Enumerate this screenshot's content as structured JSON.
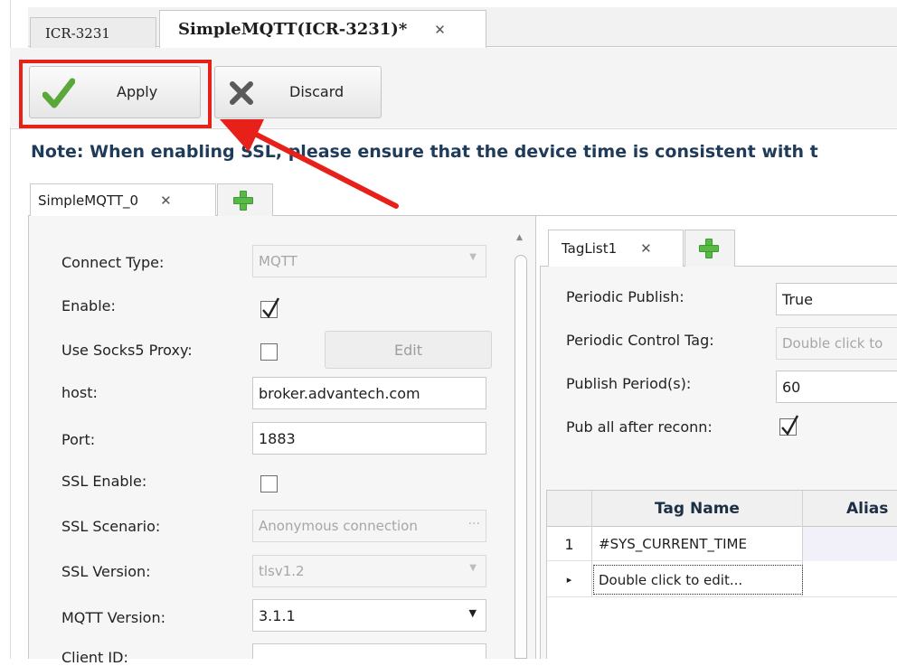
{
  "doc_tabs": [
    {
      "label": "ICR-3231"
    },
    {
      "label": "SimpleMQTT(ICR-3231)*",
      "close": "✕"
    }
  ],
  "toolbar": {
    "apply_label": "Apply",
    "discard_label": "Discard"
  },
  "note": "Note: When enabling SSL, please ensure that the device time is consistent with t",
  "config_tabs": {
    "active": "SimpleMQTT_0",
    "close": "✕"
  },
  "form": {
    "connect_type": {
      "label": "Connect Type:",
      "value": "MQTT"
    },
    "enable": {
      "label": "Enable:",
      "checked": true
    },
    "socks5": {
      "label": "Use Socks5 Proxy:",
      "checked": false,
      "edit_label": "Edit"
    },
    "host": {
      "label": "host:",
      "value": "broker.advantech.com"
    },
    "port": {
      "label": "Port:",
      "value": "1883"
    },
    "ssl_enable": {
      "label": "SSL Enable:",
      "checked": false
    },
    "ssl_scenario": {
      "label": "SSL Scenario:",
      "value": "Anonymous connection",
      "ellipsis": "···"
    },
    "ssl_version": {
      "label": "SSL Version:",
      "value": "tlsv1.2"
    },
    "mqtt_version": {
      "label": "MQTT Version:",
      "value": "3.1.1"
    },
    "client_id": {
      "label": "Client ID:",
      "value": ""
    }
  },
  "taglist": {
    "tab": "TagList1",
    "close": "✕",
    "periodic_publish": {
      "label": "Periodic Publish:",
      "value": "True"
    },
    "periodic_control_tag": {
      "label": "Periodic Control Tag:",
      "value": "Double click to"
    },
    "publish_period": {
      "label": "Publish Period(s):",
      "value": "60"
    },
    "pub_all": {
      "label": "Pub all after reconn:",
      "checked": true
    },
    "grid": {
      "headers": [
        "Tag Name",
        "Alias"
      ],
      "rows": [
        {
          "num": "1",
          "tag": "#SYS_CURRENT_TIME",
          "alias": ""
        },
        {
          "num": "",
          "tag": "Double click to edit...",
          "alias": ""
        }
      ],
      "current_row_marker": "▸"
    }
  },
  "annotation": {
    "color": "#e8201a"
  }
}
